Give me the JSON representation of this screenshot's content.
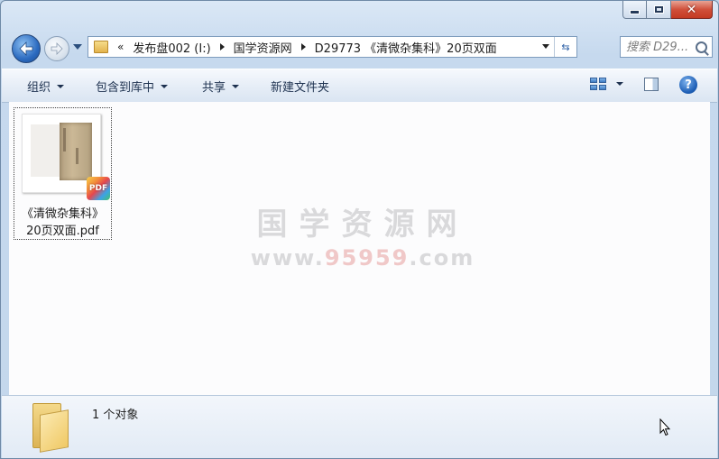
{
  "window": {
    "caption": {
      "minimize": "—",
      "maximize": "▢",
      "close": "✕"
    }
  },
  "nav": {
    "breadcrumb_prefix": "«",
    "crumbs": [
      "发布盘002 (I:)",
      "国学资源网",
      "D29773 《清微杂集科》20页双面"
    ],
    "search_placeholder": "搜索 D29...",
    "refresh_icon": "⇆"
  },
  "toolbar": {
    "organize": "组织",
    "include_in_library": "包含到库中",
    "share": "共享",
    "new_folder": "新建文件夹",
    "help": "?"
  },
  "content": {
    "files": [
      {
        "name_line1": "《清微杂集科》",
        "name_line2": "20页双面.pdf",
        "badge": "PDF"
      }
    ],
    "watermark": {
      "cn": "国学资源网",
      "url_prefix": "www.",
      "url_hl": "95959",
      "url_suffix": ".com"
    }
  },
  "details": {
    "count": "1 个对象"
  },
  "colors": {
    "title_bg": "#c6d9ee",
    "content_bg": "#fcfcfd",
    "close_red": "#c43a22",
    "folder_yellow": "#f0c965"
  }
}
